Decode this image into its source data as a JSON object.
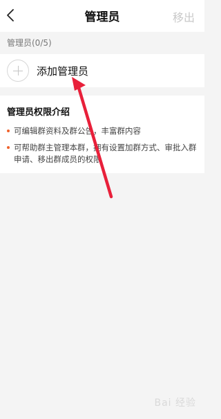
{
  "navbar": {
    "back_icon": "chevron-left-icon",
    "title": "管理员",
    "action_label": "移出"
  },
  "admins": {
    "section_header": "管理员(0/5)",
    "add_icon": "plus-icon",
    "add_label": "添加管理员"
  },
  "permissions": {
    "title": "管理员权限介绍",
    "items": [
      {
        "text": "可编辑群资料及群公告，丰富群内容"
      },
      {
        "text": "可帮助群主管理本群，拥有设置加群方式、审批入群申请、移出群成员的权限"
      }
    ]
  },
  "watermark": {
    "text": "Bai 经验"
  },
  "colors": {
    "accent_dot": "#f0622c",
    "annotation_arrow": "#e8203a",
    "disabled_text": "#c9c9c9"
  }
}
